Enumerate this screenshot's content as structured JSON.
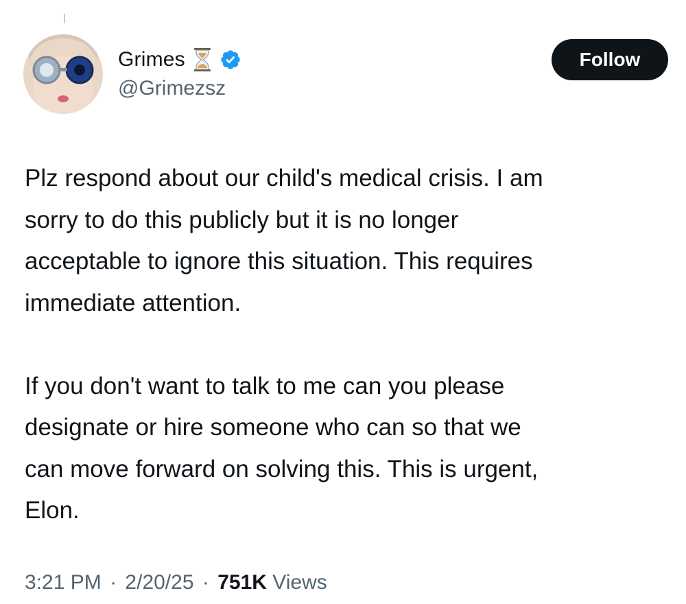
{
  "author": {
    "display_name": "Grimes",
    "handle": "@Grimezsz",
    "name_emoji": "hourglass-icon",
    "verified_badge": "verified-icon"
  },
  "follow_button": {
    "label": "Follow"
  },
  "tweet": {
    "paragraphs": [
      "Plz respond about our child's medical crisis.  I am\nsorry to do this publicly but it is no longer\nacceptable to ignore this situation.  This requires\nimmediate attention.",
      "If you don't want to talk to me can you please\ndesignate or hire someone who can so that we\ncan move forward on solving this.   This is urgent,\nElon."
    ]
  },
  "meta": {
    "time": "3:21 PM",
    "separator": "·",
    "date": "2/20/25",
    "views_count": "751K",
    "views_label": "Views"
  },
  "colors": {
    "text": "#0f1419",
    "secondary": "#536471",
    "verified": "#1d9bf0",
    "follow_bg": "#0f1419"
  }
}
